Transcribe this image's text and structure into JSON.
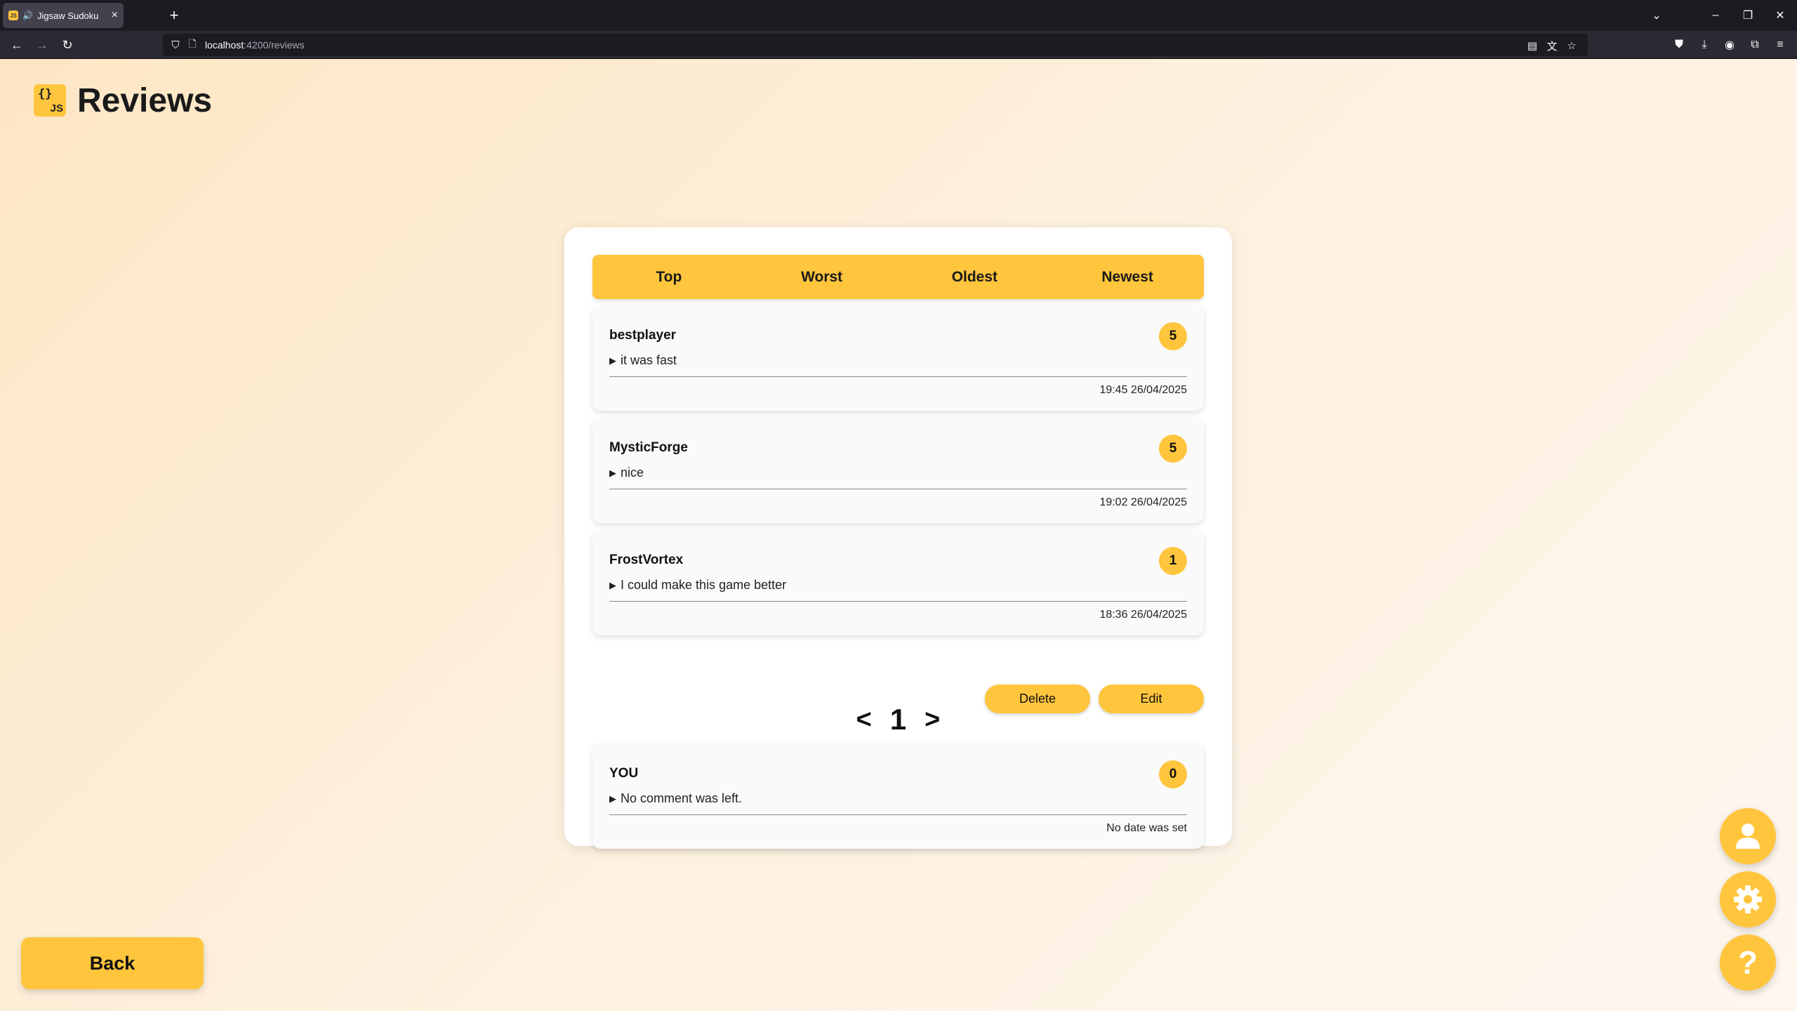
{
  "browser": {
    "tab_title": "Jigsaw Sudoku",
    "tab_favicon": "JS",
    "url_host": "localhost",
    "url_path": ":4200/reviews"
  },
  "header": {
    "logo_braces": "{}",
    "logo_js": "JS",
    "title": "Reviews"
  },
  "sort_tabs": [
    "Top",
    "Worst",
    "Oldest",
    "Newest"
  ],
  "reviews": [
    {
      "author": "bestplayer",
      "rating": "5",
      "comment": "it was fast",
      "date": "19:45 26/04/2025"
    },
    {
      "author": "MysticForge",
      "rating": "5",
      "comment": "nice",
      "date": "19:02 26/04/2025"
    },
    {
      "author": "FrostVortex",
      "rating": "1",
      "comment": "I could make this game better",
      "date": "18:36 26/04/2025"
    }
  ],
  "pagination": {
    "prev": "<",
    "page": "1",
    "next": ">"
  },
  "my_review": {
    "author": "YOU",
    "rating": "0",
    "comment": "No comment was left.",
    "date": "No date was set"
  },
  "actions": {
    "delete_label": "Delete",
    "edit_label": "Edit"
  },
  "back_label": "Back",
  "fabs": [
    {
      "icon": "user-icon"
    },
    {
      "icon": "gear-icon"
    },
    {
      "icon": "question-icon",
      "symbol": "?"
    }
  ],
  "colors": {
    "accent": "#ffc53d",
    "card": "#ffffff",
    "review_bg": "#fafafa"
  }
}
